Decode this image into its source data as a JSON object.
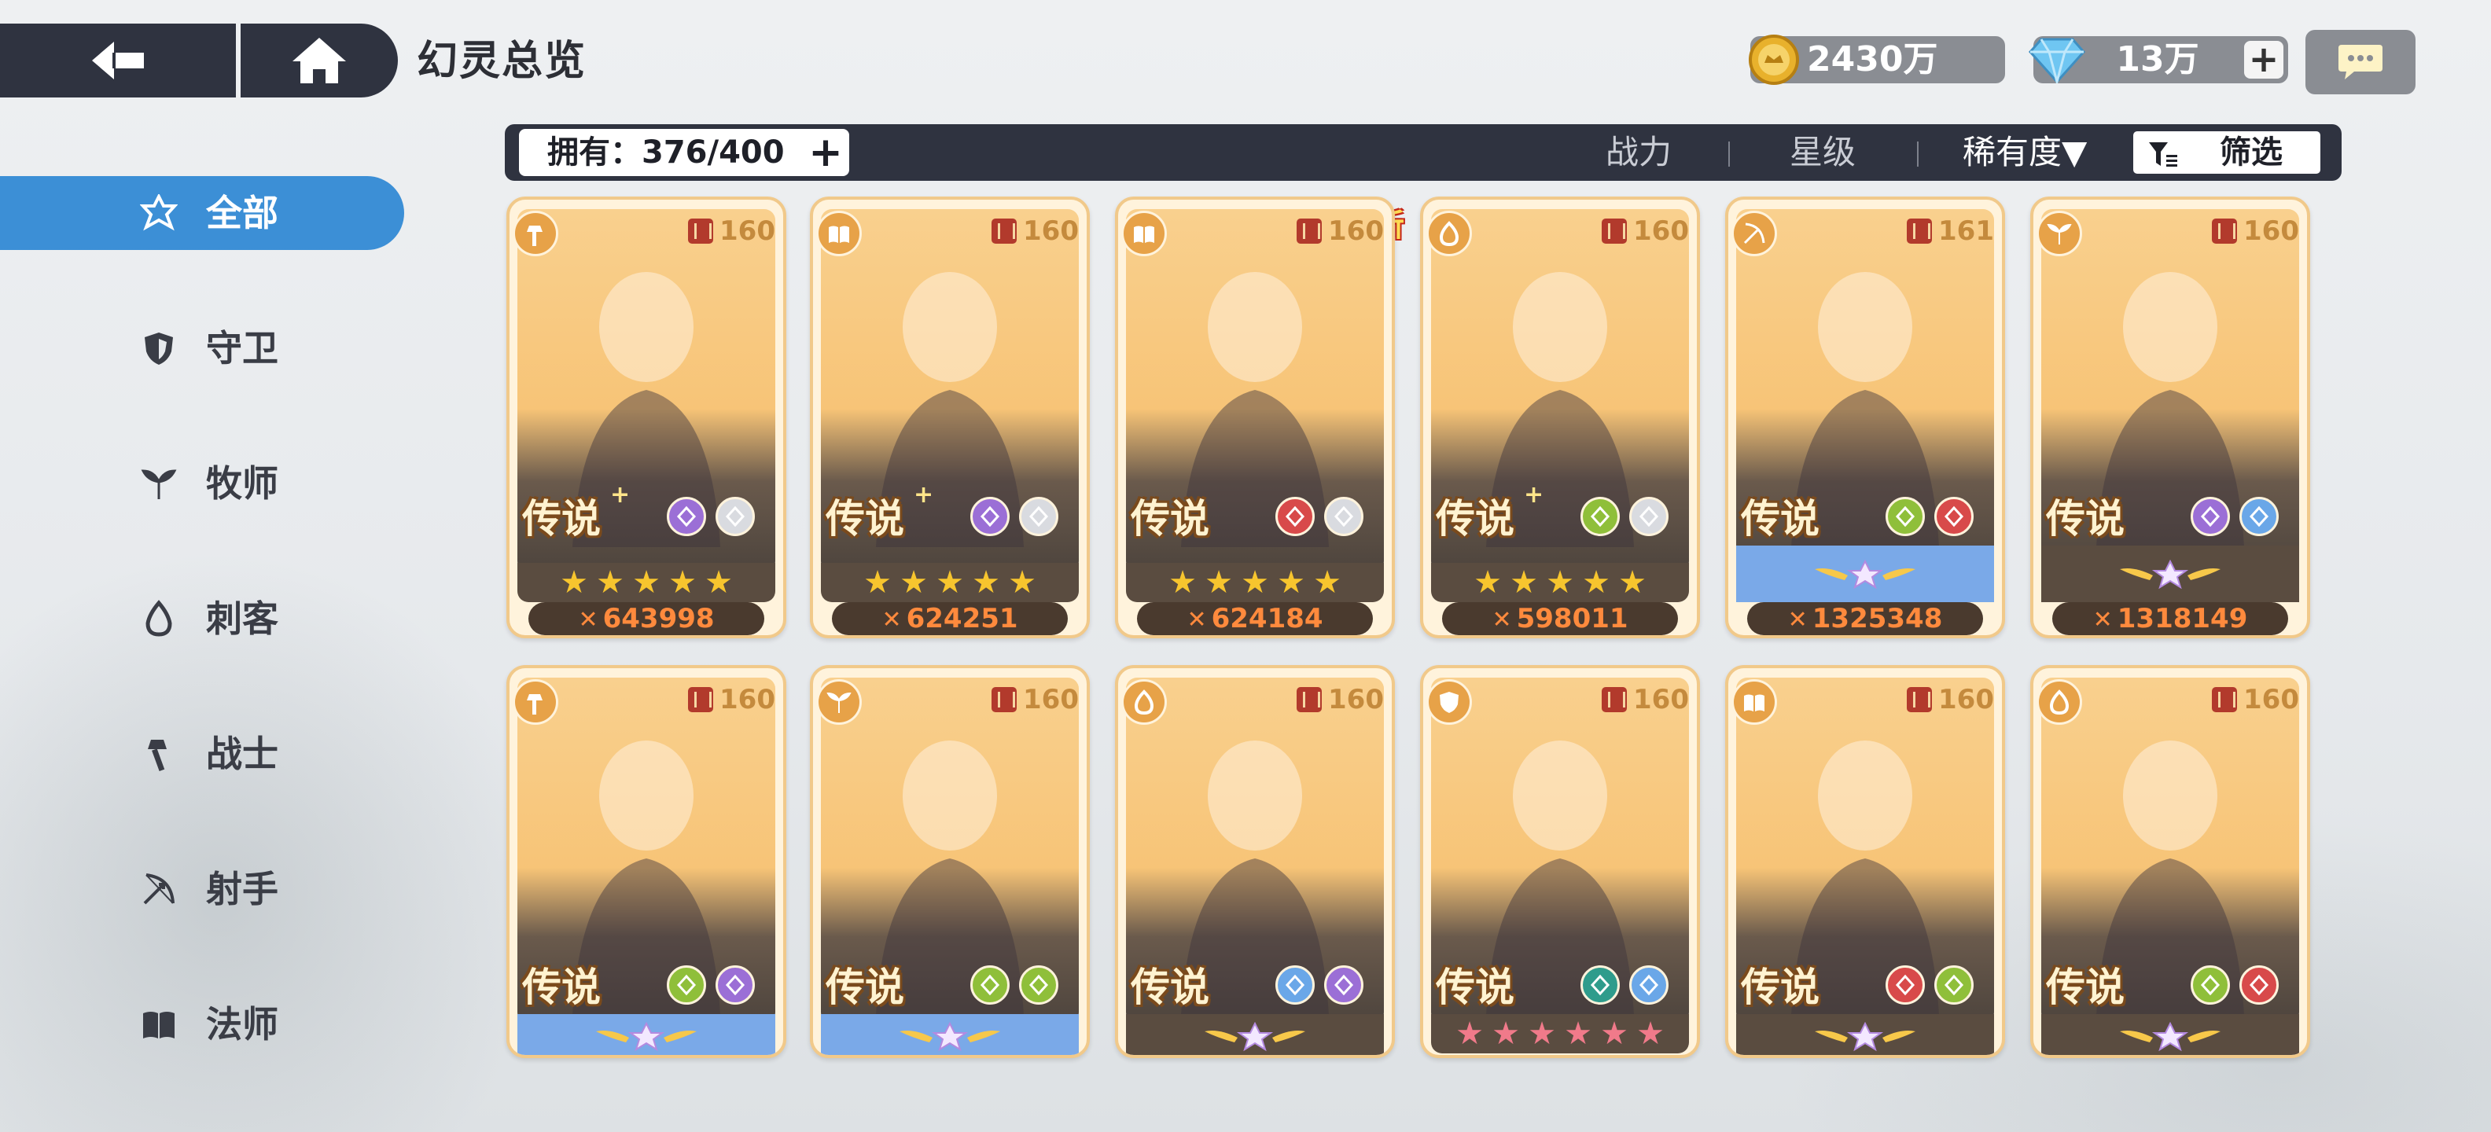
{
  "header": {
    "title": "幻灵总览",
    "gold": "2430万",
    "gems": "13万",
    "plus": "+"
  },
  "filter": {
    "owned": "拥有：376/400",
    "plus": "+",
    "sort_power": "战力",
    "sort_star": "星级",
    "sort_rarity": "稀有度▼",
    "filter_label": "筛选"
  },
  "nav": [
    {
      "label": "全部",
      "icon": "hexagram-icon"
    },
    {
      "label": "守卫",
      "icon": "shield-icon"
    },
    {
      "label": "牧师",
      "icon": "wing-leaf-icon"
    },
    {
      "label": "刺客",
      "icon": "flame-icon"
    },
    {
      "label": "战士",
      "icon": "hammer-icon"
    },
    {
      "label": "射手",
      "icon": "bow-icon"
    },
    {
      "label": "法师",
      "icon": "book-icon"
    }
  ],
  "cards": [
    {
      "level": "160",
      "rarity": "传说",
      "plus": "+",
      "class": "hammer",
      "attrs": [
        "purple",
        "white"
      ],
      "stars": 5,
      "star_color": "gold",
      "power": "643998"
    },
    {
      "level": "160",
      "rarity": "传说",
      "plus": "+",
      "class": "book",
      "attrs": [
        "purple",
        "white"
      ],
      "stars": 5,
      "star_color": "gold",
      "power": "624251"
    },
    {
      "level": "160",
      "rarity": "传说",
      "plus": "",
      "class": "book",
      "attrs": [
        "red",
        "white"
      ],
      "stars": 5,
      "star_color": "gold",
      "power": "624184",
      "badge": "新"
    },
    {
      "level": "160",
      "rarity": "传说",
      "plus": "+",
      "class": "flame",
      "attrs": [
        "green",
        "white"
      ],
      "stars": 5,
      "star_color": "gold",
      "power": "598011"
    },
    {
      "level": "161",
      "rarity": "传说",
      "plus": "",
      "class": "bow",
      "attrs": [
        "green",
        "red"
      ],
      "awaken": "blue",
      "power": "1325348"
    },
    {
      "level": "160",
      "rarity": "传说",
      "plus": "",
      "class": "leaf",
      "attrs": [
        "purple",
        "blue"
      ],
      "awaken": "plain",
      "power": "1318149"
    },
    {
      "level": "160",
      "rarity": "传说",
      "plus": "",
      "class": "hammer",
      "attrs": [
        "green",
        "purple"
      ],
      "awaken": "blue"
    },
    {
      "level": "160",
      "rarity": "传说",
      "plus": "",
      "class": "leaf",
      "attrs": [
        "green",
        "green"
      ],
      "awaken": "blue"
    },
    {
      "level": "160",
      "rarity": "传说",
      "plus": "",
      "class": "flame",
      "attrs": [
        "blue",
        "purple"
      ],
      "awaken": "plain"
    },
    {
      "level": "160",
      "rarity": "传说",
      "plus": "",
      "class": "shield",
      "attrs": [
        "teal",
        "blue"
      ],
      "stars": 6,
      "star_color": "pink"
    },
    {
      "level": "160",
      "rarity": "传说",
      "plus": "",
      "class": "book",
      "attrs": [
        "red",
        "green"
      ],
      "awaken": "plain"
    },
    {
      "level": "160",
      "rarity": "传说",
      "plus": "",
      "class": "flame",
      "attrs": [
        "green",
        "red"
      ],
      "awaken": "plain"
    }
  ]
}
